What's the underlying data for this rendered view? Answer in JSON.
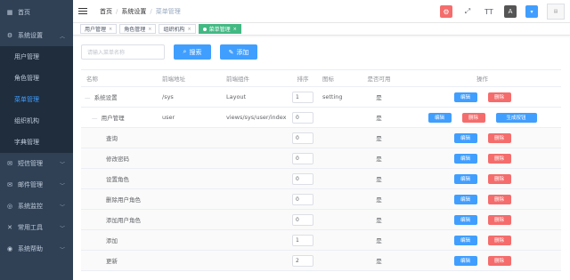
{
  "sidebar": {
    "items": [
      {
        "label": "首页",
        "icon": "dashboard-icon",
        "expandable": false
      },
      {
        "label": "系统设置",
        "icon": "gear-icon",
        "expandable": true,
        "expanded": true,
        "children": [
          {
            "label": "用户管理",
            "active": false
          },
          {
            "label": "角色管理",
            "active": false
          },
          {
            "label": "菜单管理",
            "active": true
          },
          {
            "label": "组织机构",
            "active": false
          },
          {
            "label": "字典管理",
            "active": false
          }
        ]
      },
      {
        "label": "短信管理",
        "icon": "message-icon",
        "expandable": true
      },
      {
        "label": "邮件管理",
        "icon": "mail-icon",
        "expandable": true
      },
      {
        "label": "系统监控",
        "icon": "monitor-icon",
        "expandable": true
      },
      {
        "label": "常用工具",
        "icon": "tools-icon",
        "expandable": true
      },
      {
        "label": "系统帮助",
        "icon": "help-icon",
        "expandable": true
      }
    ]
  },
  "header": {
    "breadcrumb": [
      "首页",
      "系统设置",
      "菜单管理"
    ]
  },
  "tags": [
    {
      "label": "用户管理",
      "active": false
    },
    {
      "label": "角色管理",
      "active": false
    },
    {
      "label": "组织机构",
      "active": false
    },
    {
      "label": "菜单管理",
      "active": true
    }
  ],
  "search": {
    "placeholder": "请输入菜单名称",
    "search_label": "搜索",
    "add_label": "添加"
  },
  "table": {
    "headers": [
      "名称",
      "前端地址",
      "前端组件",
      "排序",
      "图标",
      "是否可用",
      "操作"
    ],
    "rows": [
      {
        "name": "系统设置",
        "level": 0,
        "url": "/sys",
        "component": "Layout",
        "order": "1",
        "icon": "setting",
        "visible": "是",
        "ops": [
          "编辑",
          "删除"
        ]
      },
      {
        "name": "用户管理",
        "level": 1,
        "url": "user",
        "component": "views/sys/user/index",
        "order": "0",
        "icon": "",
        "visible": "是",
        "ops": [
          "编辑",
          "删除",
          "生成按钮"
        ]
      },
      {
        "name": "查询",
        "level": 2,
        "url": "",
        "component": "",
        "order": "0",
        "icon": "",
        "visible": "是",
        "ops": [
          "编辑",
          "删除"
        ]
      },
      {
        "name": "修改密码",
        "level": 2,
        "url": "",
        "component": "",
        "order": "0",
        "icon": "",
        "visible": "是",
        "ops": [
          "编辑",
          "删除"
        ]
      },
      {
        "name": "设置角色",
        "level": 2,
        "url": "",
        "component": "",
        "order": "0",
        "icon": "",
        "visible": "是",
        "ops": [
          "编辑",
          "删除"
        ]
      },
      {
        "name": "删除用户角色",
        "level": 2,
        "url": "",
        "component": "",
        "order": "0",
        "icon": "",
        "visible": "是",
        "ops": [
          "编辑",
          "删除"
        ]
      },
      {
        "name": "添加用户角色",
        "level": 2,
        "url": "",
        "component": "",
        "order": "0",
        "icon": "",
        "visible": "是",
        "ops": [
          "编辑",
          "删除"
        ]
      },
      {
        "name": "添加",
        "level": 2,
        "url": "",
        "component": "",
        "order": "1",
        "icon": "",
        "visible": "是",
        "ops": [
          "编辑",
          "删除"
        ]
      },
      {
        "name": "更新",
        "level": 2,
        "url": "",
        "component": "",
        "order": "2",
        "icon": "",
        "visible": "是",
        "ops": [
          "编辑",
          "删除"
        ]
      }
    ]
  },
  "colors": {
    "sidebar_bg": "#304156",
    "submenu_bg": "#1f2d3d",
    "primary": "#409eff",
    "danger": "#f56c6c",
    "active_tag": "#42b983"
  }
}
